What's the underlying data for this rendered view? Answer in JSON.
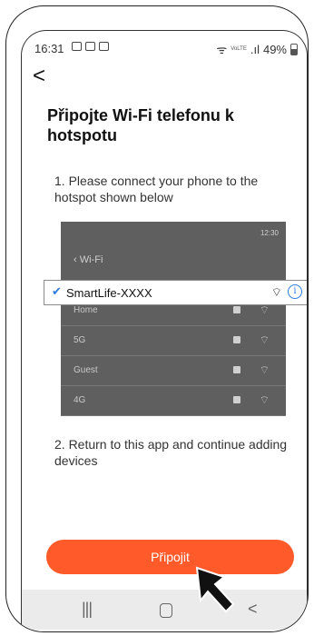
{
  "status_bar": {
    "time": "16:31",
    "volte_label": "VoLTE",
    "battery": "49%"
  },
  "back_glyph": "<",
  "title": "Připojte Wi-Fi telefonu k hotspotu",
  "step1": "1. Please connect your phone to the hotspot shown below",
  "wifi_panel": {
    "time": "12:30",
    "header": "Wi-Fi",
    "selected_network": "SmartLife-XXXX",
    "networks": [
      "Home",
      "5G",
      "Guest",
      "4G"
    ]
  },
  "step2": "2. Return to this app and continue adding devices",
  "connect_button": "Připojit",
  "nav": {
    "recent_glyph": "|||",
    "back_glyph": "<"
  },
  "colors": {
    "accent": "#ff5a2a",
    "panel_bg": "#5f5f5f",
    "check_blue": "#2d7be5"
  }
}
